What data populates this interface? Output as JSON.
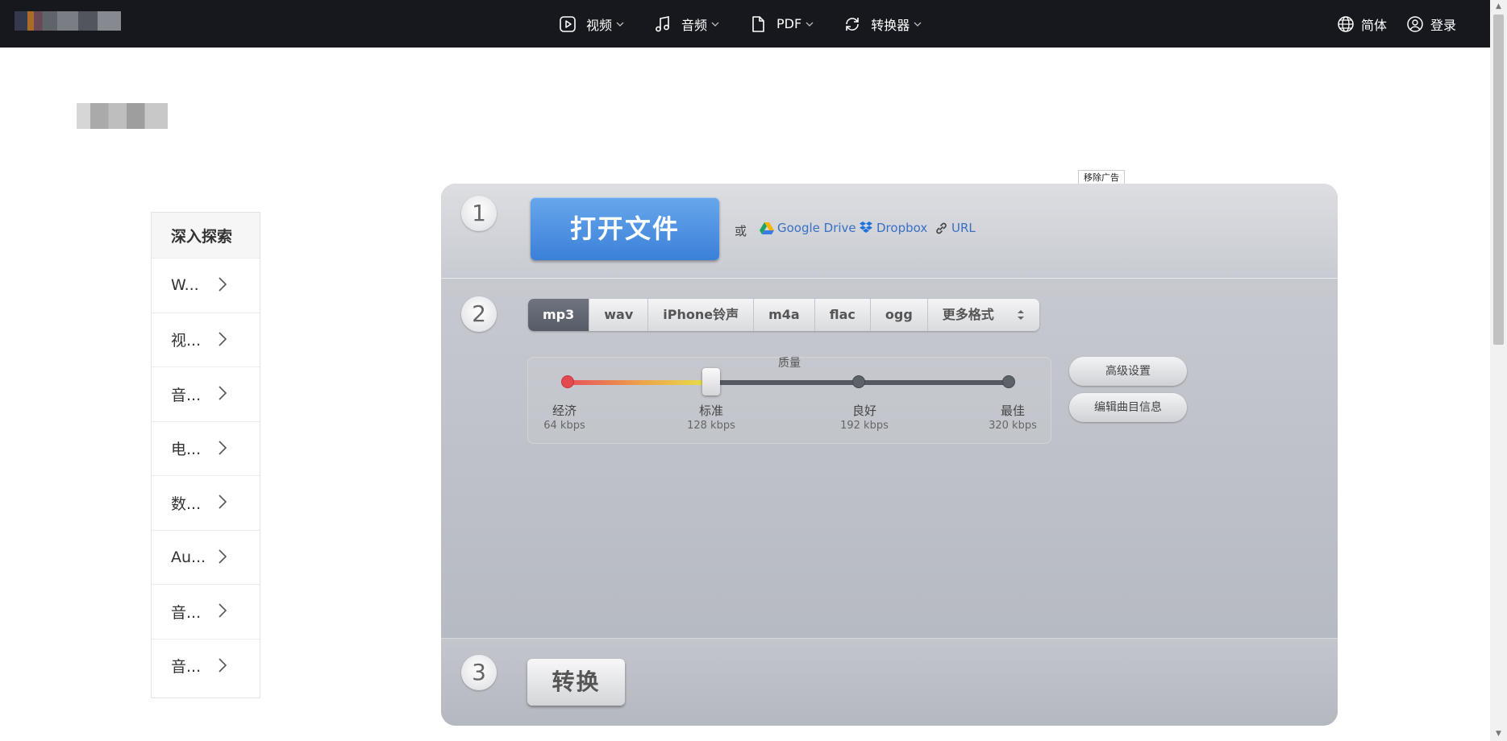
{
  "nav": {
    "items": [
      {
        "label": "视频",
        "icon": "play-square-icon"
      },
      {
        "label": "音频",
        "icon": "music-note-icon"
      },
      {
        "label": "PDF",
        "icon": "file-icon"
      },
      {
        "label": "转换器",
        "icon": "refresh-icon"
      }
    ],
    "language": "简体",
    "login": "登录"
  },
  "sidebar": {
    "title": "深入探索",
    "items": [
      "W...",
      "视...",
      "音...",
      "电...",
      "数...",
      "Au...",
      "音...",
      "音..."
    ]
  },
  "ad": {
    "remove_label": "移除广告"
  },
  "step1": {
    "number": "1",
    "open_button": "打开文件",
    "or_label": "或",
    "sources": [
      "Google Drive",
      "Dropbox",
      "URL"
    ]
  },
  "step2": {
    "number": "2",
    "formats": [
      "mp3",
      "wav",
      "iPhone铃声",
      "m4a",
      "flac",
      "ogg",
      "更多格式"
    ],
    "selected_format": "mp3",
    "quality": {
      "title": "质量",
      "levels": [
        {
          "name": "经济",
          "rate": "64 kbps"
        },
        {
          "name": "标准",
          "rate": "128 kbps"
        },
        {
          "name": "良好",
          "rate": "192 kbps"
        },
        {
          "name": "最佳",
          "rate": "320 kbps"
        }
      ],
      "selected_level": "标准"
    },
    "advanced_button": "高级设置",
    "edit_info_button": "编辑曲目信息"
  },
  "step3": {
    "number": "3",
    "convert_button": "转换"
  },
  "colors": {
    "topbar": "#16181d",
    "open_button": "#3b80d8",
    "link": "#3a6fc4",
    "active_format": "#5f6470"
  }
}
